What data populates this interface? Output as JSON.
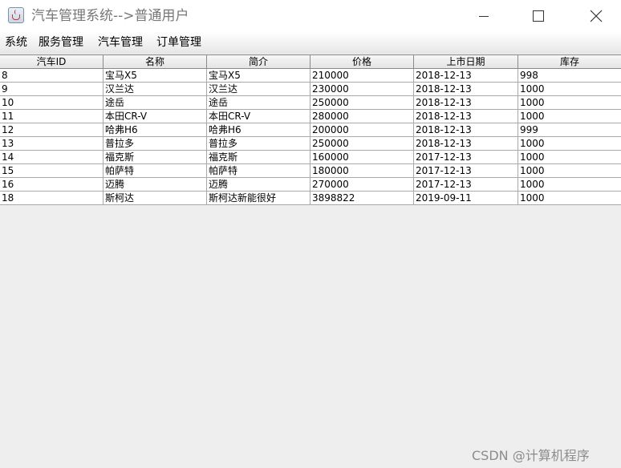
{
  "window": {
    "title": "汽车管理系统-->普通用户",
    "controls": [
      "minimize",
      "maximize",
      "close"
    ]
  },
  "menu": [
    "系统",
    "服务管理",
    "汽车管理",
    "订单管理"
  ],
  "table": {
    "columns": [
      "汽车ID",
      "名称",
      "简介",
      "价格",
      "上市日期",
      "库存"
    ],
    "rows": [
      [
        "8",
        "宝马X5",
        "宝马X5",
        "210000",
        "2018-12-13",
        "998"
      ],
      [
        "9",
        "汉兰达",
        "汉兰达",
        "230000",
        "2018-12-13",
        "1000"
      ],
      [
        "10",
        "途岳",
        "途岳",
        "250000",
        "2018-12-13",
        "1000"
      ],
      [
        "11",
        "本田CR-V",
        "本田CR-V",
        "280000",
        "2018-12-13",
        "1000"
      ],
      [
        "12",
        "哈弗H6",
        "哈弗H6",
        "200000",
        "2018-12-13",
        "999"
      ],
      [
        "13",
        "普拉多",
        "普拉多",
        "250000",
        "2018-12-13",
        "1000"
      ],
      [
        "14",
        "福克斯",
        "福克斯",
        "160000",
        "2017-12-13",
        "1000"
      ],
      [
        "15",
        "帕萨特",
        "帕萨特",
        "180000",
        "2017-12-13",
        "1000"
      ],
      [
        "16",
        "迈腾",
        "迈腾",
        "270000",
        "2017-12-13",
        "1000"
      ],
      [
        "18",
        "斯柯达",
        "斯柯达新能很好",
        "3898822",
        "2019-09-11",
        "1000"
      ]
    ]
  },
  "watermark": "CSDN @计算机程序"
}
